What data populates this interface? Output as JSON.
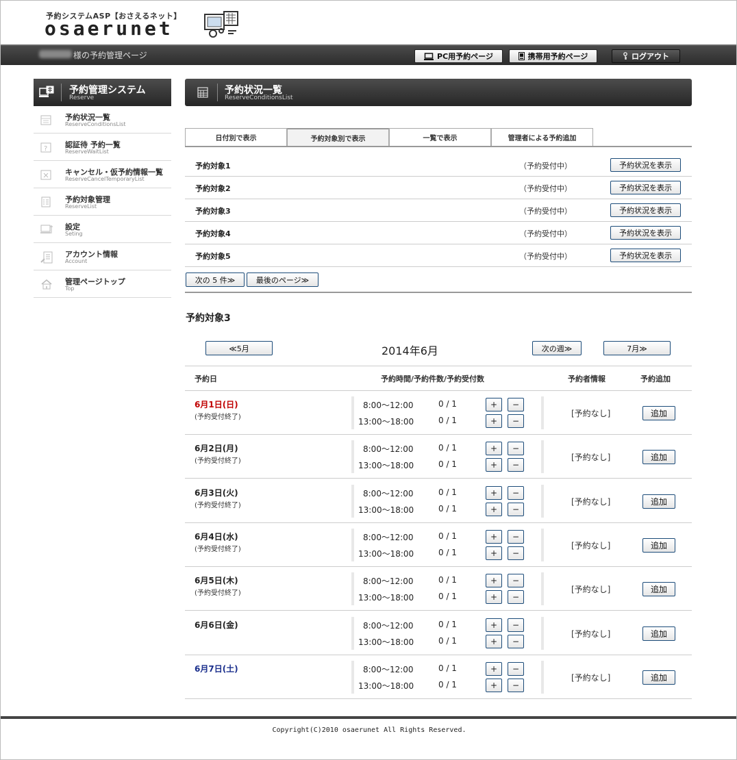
{
  "header": {
    "logo_sub": "予約システムASP【おさえるネット】",
    "logo_main": "osaerunet",
    "user_suffix": "様の予約管理ページ",
    "pc_button": "PC用予約ページ",
    "mobile_button": "携帯用予約ページ",
    "logout_button": "ログアウト"
  },
  "sidebar": {
    "title": "予約管理システム",
    "subtitle": "Reserve",
    "items": [
      {
        "label": "予約状況一覧",
        "sub": "ReserveConditionsList",
        "icon": "calendar-icon"
      },
      {
        "label": "認証待 予約一覧",
        "sub": "ReserveWaitList",
        "icon": "waiting-icon"
      },
      {
        "label": "キャンセル・仮予約情報一覧",
        "sub": "ReserveCancelTemporaryList",
        "icon": "cancel-icon"
      },
      {
        "label": "予約対象管理",
        "sub": "ReserveList",
        "icon": "list-icon"
      },
      {
        "label": "設定",
        "sub": "Seting",
        "icon": "settings-icon"
      },
      {
        "label": "アカウント情報",
        "sub": "Account",
        "icon": "account-icon"
      },
      {
        "label": "管理ページトップ",
        "sub": "Top",
        "icon": "home-icon"
      }
    ]
  },
  "main": {
    "title": "予約状況一覧",
    "subtitle": "ReserveConditionsList",
    "tabs": [
      {
        "label": "日付別で表示"
      },
      {
        "label": "予約対象別で表示"
      },
      {
        "label": "一覧で表示"
      },
      {
        "label": "管理者による予約追加"
      }
    ],
    "targets": [
      {
        "name": "予約対象1",
        "status": "（予約受付中）",
        "button": "予約状況を表示"
      },
      {
        "name": "予約対象2",
        "status": "（予約受付中）",
        "button": "予約状況を表示"
      },
      {
        "name": "予約対象3",
        "status": "（予約受付中）",
        "button": "予約状況を表示"
      },
      {
        "name": "予約対象4",
        "status": "（予約受付中）",
        "button": "予約状況を表示"
      },
      {
        "name": "予約対象5",
        "status": "（予約受付中）",
        "button": "予約状況を表示"
      }
    ],
    "pager": {
      "next": "次の 5 件≫",
      "last": "最後のページ≫"
    },
    "selected_title": "予約対象3",
    "calendar_nav": {
      "prev_month": "≪5月",
      "month": "2014年6月",
      "next_week": "次の週≫",
      "next_month": "7月≫"
    },
    "columns": {
      "date": "予約日",
      "slots": "予約時間/予約件数/予約受付数",
      "booker": "予約者情報",
      "add": "予約追加"
    },
    "days": [
      {
        "date": "6月1日(日)",
        "kind": "sun",
        "note": "(予約受付終了)",
        "slots": [
          {
            "time": "8:00〜12:00",
            "count": "0 / 1"
          },
          {
            "time": "13:00〜18:00",
            "count": "0 / 1"
          }
        ],
        "reservation": "[予約なし]",
        "add": "追加"
      },
      {
        "date": "6月2日(月)",
        "kind": "",
        "note": "(予約受付終了)",
        "slots": [
          {
            "time": "8:00〜12:00",
            "count": "0 / 1"
          },
          {
            "time": "13:00〜18:00",
            "count": "0 / 1"
          }
        ],
        "reservation": "[予約なし]",
        "add": "追加"
      },
      {
        "date": "6月3日(火)",
        "kind": "",
        "note": "(予約受付終了)",
        "slots": [
          {
            "time": "8:00〜12:00",
            "count": "0 / 1"
          },
          {
            "time": "13:00〜18:00",
            "count": "0 / 1"
          }
        ],
        "reservation": "[予約なし]",
        "add": "追加"
      },
      {
        "date": "6月4日(水)",
        "kind": "",
        "note": "(予約受付終了)",
        "slots": [
          {
            "time": "8:00〜12:00",
            "count": "0 / 1"
          },
          {
            "time": "13:00〜18:00",
            "count": "0 / 1"
          }
        ],
        "reservation": "[予約なし]",
        "add": "追加"
      },
      {
        "date": "6月5日(木)",
        "kind": "",
        "note": "(予約受付終了)",
        "slots": [
          {
            "time": "8:00〜12:00",
            "count": "0 / 1"
          },
          {
            "time": "13:00〜18:00",
            "count": "0 / 1"
          }
        ],
        "reservation": "[予約なし]",
        "add": "追加"
      },
      {
        "date": "6月6日(金)",
        "kind": "",
        "note": "",
        "slots": [
          {
            "time": "8:00〜12:00",
            "count": "0 / 1"
          },
          {
            "time": "13:00〜18:00",
            "count": "0 / 1"
          }
        ],
        "reservation": "[予約なし]",
        "add": "追加"
      },
      {
        "date": "6月7日(土)",
        "kind": "sat",
        "note": "",
        "slots": [
          {
            "time": "8:00〜12:00",
            "count": "0 / 1"
          },
          {
            "time": "13:00〜18:00",
            "count": "0 / 1"
          }
        ],
        "reservation": "[予約なし]",
        "add": "追加"
      }
    ],
    "plus": "+",
    "minus": "−"
  },
  "footer": {
    "copyright": "Copyright(C)2010 osaerunet All Rights Reserved."
  },
  "colors": {
    "sunday": "#c00000",
    "saturday": "#1a2e8c",
    "header_dark": "#2c2c2c",
    "button_border": "#1a4a78"
  }
}
